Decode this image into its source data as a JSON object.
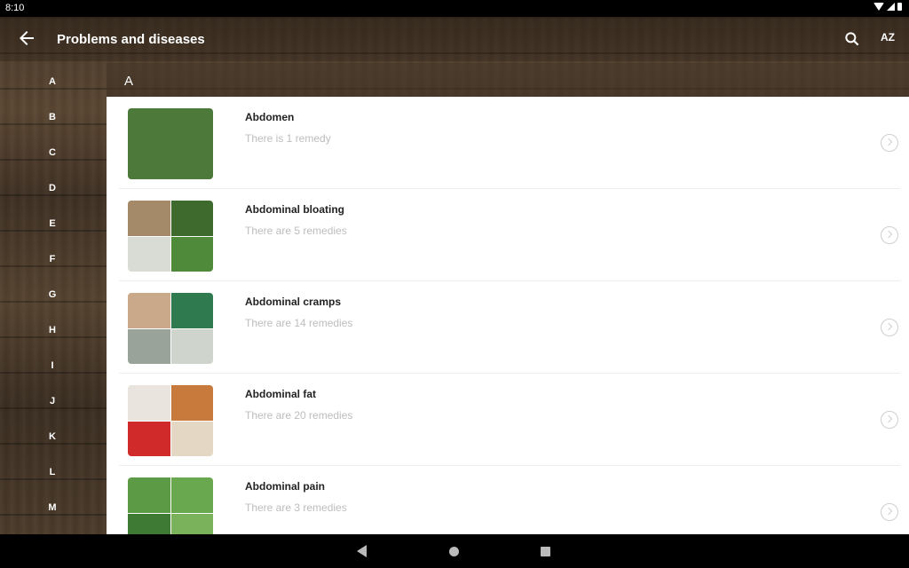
{
  "status": {
    "time": "8:10"
  },
  "app_bar": {
    "title": "Problems and diseases",
    "sort_label": "AZ"
  },
  "index": [
    "A",
    "B",
    "C",
    "D",
    "E",
    "F",
    "G",
    "H",
    "I",
    "J",
    "K",
    "L",
    "M"
  ],
  "section": {
    "letter": "A"
  },
  "items": [
    {
      "title": "Abdomen",
      "subtitle": "There is 1 remedy",
      "thumb": [
        "#4d7a3a"
      ]
    },
    {
      "title": "Abdominal bloating",
      "subtitle": "There are 5 remedies",
      "thumb": [
        "#a58a6a",
        "#3e6a2e",
        "#d8dcd4",
        "#4f8a3a"
      ]
    },
    {
      "title": "Abdominal cramps",
      "subtitle": "There are 14 remedies",
      "thumb": [
        "#caa98a",
        "#2f7a4e",
        "#9aa39a",
        "#cfd5cc"
      ]
    },
    {
      "title": "Abdominal fat",
      "subtitle": "There are 20 remedies",
      "thumb": [
        "#e9e4de",
        "#c77a3c",
        "#d12a2a",
        "#e4d7c4"
      ]
    },
    {
      "title": "Abdominal pain",
      "subtitle": "There are 3 remedies",
      "thumb": [
        "#5d9a45",
        "#6aa84f",
        "#3f7a34",
        "#79b25a"
      ]
    }
  ],
  "icons": {
    "back": "arrow-left-icon",
    "search": "search-icon",
    "sort": "sort-az-icon",
    "row_action": "chevron-right-circle-icon"
  }
}
